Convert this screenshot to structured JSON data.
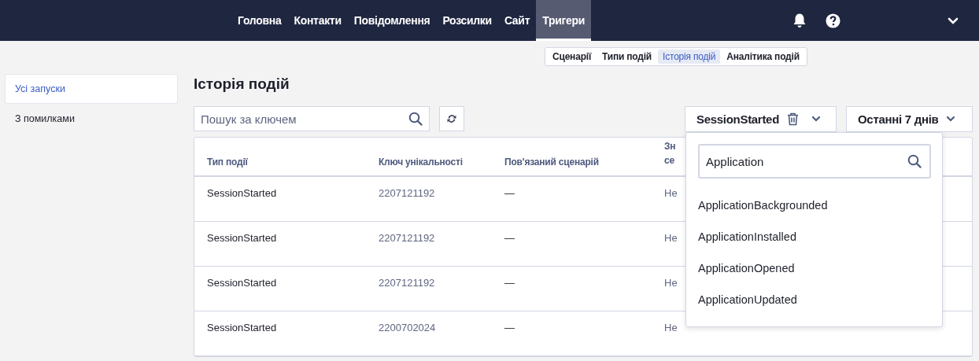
{
  "nav": {
    "items": [
      {
        "label": "Головна",
        "selected": false
      },
      {
        "label": "Контакти",
        "selected": false
      },
      {
        "label": "Повідомлення",
        "selected": false
      },
      {
        "label": "Розсилки",
        "selected": false
      },
      {
        "label": "Сайт",
        "selected": false
      },
      {
        "label": "Тригери",
        "selected": true
      }
    ]
  },
  "subtabs": [
    {
      "label": "Сценарії",
      "selected": false
    },
    {
      "label": "Типи подій",
      "selected": false
    },
    {
      "label": "Історія подій",
      "selected": true
    },
    {
      "label": "Аналітика подій",
      "selected": false
    }
  ],
  "sidebar": {
    "items": [
      {
        "label": "Усі запуски",
        "selected": true
      },
      {
        "label": "З помилками",
        "selected": false
      }
    ]
  },
  "page_title": "Історія подій",
  "search": {
    "placeholder": "Пошук за ключем"
  },
  "event_filter": {
    "value": "SessionStarted"
  },
  "period": {
    "value": "Останні 7 днів"
  },
  "table": {
    "columns": [
      "Тип події",
      "Ключ унікальності",
      "Пов'язаний сценарій",
      "Зн се"
    ],
    "rows": [
      [
        "SessionStarted",
        "2207121192",
        "—",
        "Не"
      ],
      [
        "SessionStarted",
        "2207121192",
        "—",
        "Не"
      ],
      [
        "SessionStarted",
        "2207121192",
        "—",
        "Не"
      ],
      [
        "SessionStarted",
        "2200702024",
        "—",
        "Не"
      ]
    ]
  },
  "dropdown": {
    "search_value": "Application",
    "options": [
      "ApplicationBackgrounded",
      "ApplicationInstalled",
      "ApplicationOpened",
      "ApplicationUpdated"
    ]
  }
}
